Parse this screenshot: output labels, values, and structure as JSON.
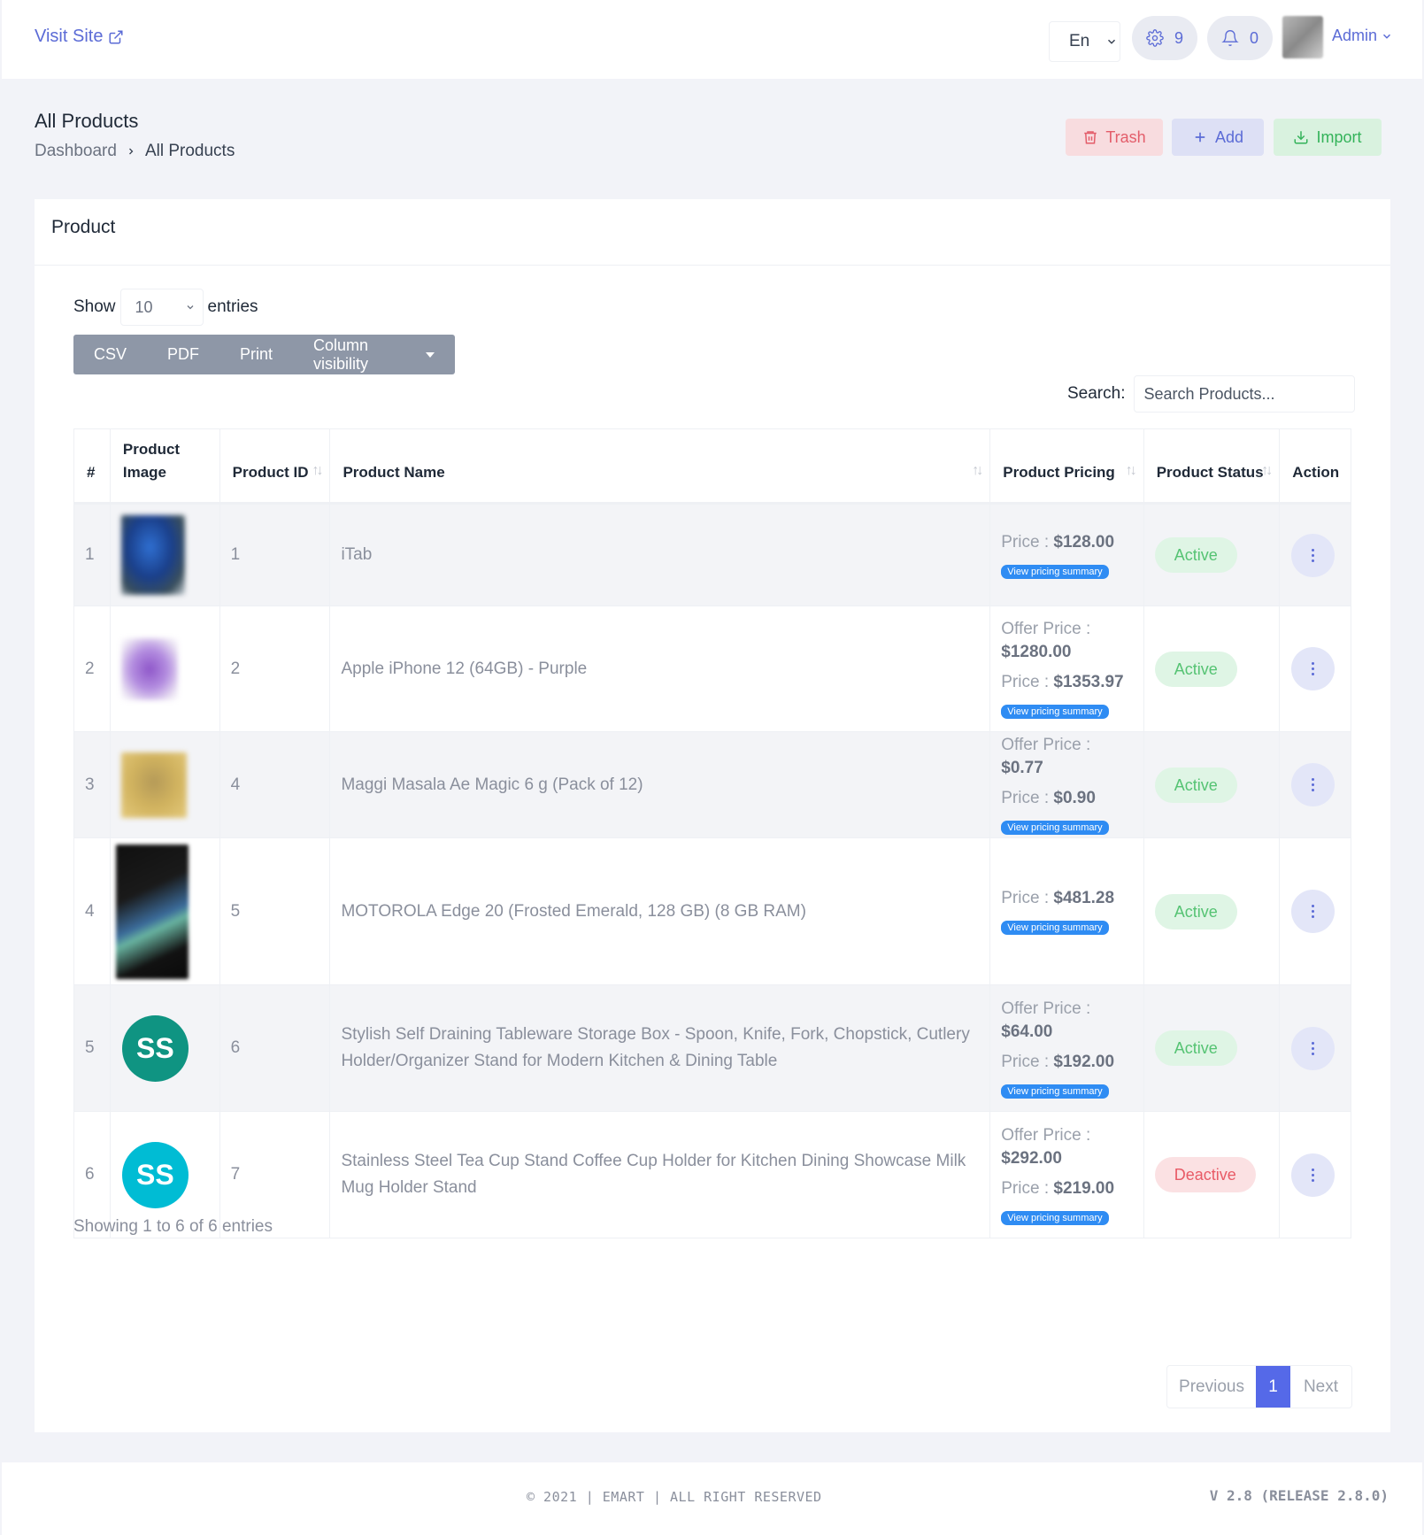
{
  "topbar": {
    "visit_site": "Visit Site",
    "language": "En",
    "settings_count": "9",
    "notifications_count": "0",
    "user": "Admin"
  },
  "header": {
    "title": "All Products",
    "breadcrumb": [
      "Dashboard",
      "All Products"
    ],
    "buttons": {
      "trash": "Trash",
      "add": "Add",
      "import": "Import"
    }
  },
  "card": {
    "title": "Product",
    "show_label": "Show",
    "entries_value": "10",
    "entries_label": "entries",
    "export_buttons": [
      "CSV",
      "PDF",
      "Print",
      "Column visibility"
    ],
    "search_label": "Search:",
    "search_placeholder": "Search Products..."
  },
  "table": {
    "headers": {
      "index": "#",
      "image": "Product Image",
      "id": "Product ID",
      "name": "Product Name",
      "pricing": "Product Pricing",
      "status": "Product Status",
      "action": "Action"
    },
    "rows": [
      {
        "index": "1",
        "image_type": "photo",
        "id": "1",
        "name": "iTab",
        "offer_label": "",
        "offer_value": "",
        "price_label": "Price : ",
        "price_value": "$128.00",
        "summary": "View pricing summary",
        "status": "Active"
      },
      {
        "index": "2",
        "image_type": "photo",
        "id": "2",
        "name": "Apple iPhone 12 (64GB) - Purple",
        "offer_label": "Offer Price : ",
        "offer_value": "$1280.00",
        "price_label": "Price : ",
        "price_value": "$1353.97",
        "summary": "View pricing summary",
        "status": "Active"
      },
      {
        "index": "3",
        "image_type": "photo",
        "id": "4",
        "name": "Maggi Masala Ae Magic 6 g (Pack of 12)",
        "offer_label": "Offer Price : ",
        "offer_value": "$0.77",
        "price_label": "Price : ",
        "price_value": "$0.90",
        "summary": "View pricing summary",
        "status": "Active"
      },
      {
        "index": "4",
        "image_type": "photo",
        "id": "5",
        "name": "MOTOROLA Edge 20 (Frosted Emerald, 128 GB) (8 GB RAM)",
        "offer_label": "",
        "offer_value": "",
        "price_label": "Price : ",
        "price_value": "$481.28",
        "summary": "View pricing summary",
        "status": "Active"
      },
      {
        "index": "5",
        "image_type": "initials",
        "initials": "SS",
        "id": "6",
        "name": "Stylish Self Draining Tableware Storage Box - Spoon, Knife, Fork, Chopstick, Cutlery Holder/Organizer Stand for Modern Kitchen & Dining Table",
        "offer_label": "Offer Price : ",
        "offer_value": "$64.00",
        "price_label": "Price : ",
        "price_value": "$192.00",
        "summary": "View pricing summary",
        "status": "Active"
      },
      {
        "index": "6",
        "image_type": "initials",
        "initials": "SS",
        "id": "7",
        "name": "Stainless Steel Tea Cup Stand Coffee Cup Holder for Kitchen Dining Showcase Milk Mug Holder Stand",
        "offer_label": "Offer Price : ",
        "offer_value": "$292.00",
        "price_label": "Price : ",
        "price_value": "$219.00",
        "summary": "View pricing summary",
        "status": "Deactive"
      }
    ]
  },
  "footer_info": {
    "showing": "Showing 1 to 6 of 6 entries",
    "pagination": {
      "previous": "Previous",
      "current": "1",
      "next": "Next"
    },
    "copyright": "© 2021 | EMART | ALL RIGHT RESERVED",
    "version": "V 2.8 (RELEASE 2.8.0)"
  },
  "colors": {
    "accent": "#5b6bd6",
    "active_bg": "#dff5e5",
    "active_text": "#55c373",
    "deactive_bg": "#fbe1e3",
    "deactive_text": "#e85a66",
    "initials_row5": "#0f9482",
    "initials_row6": "#00bcd4"
  }
}
